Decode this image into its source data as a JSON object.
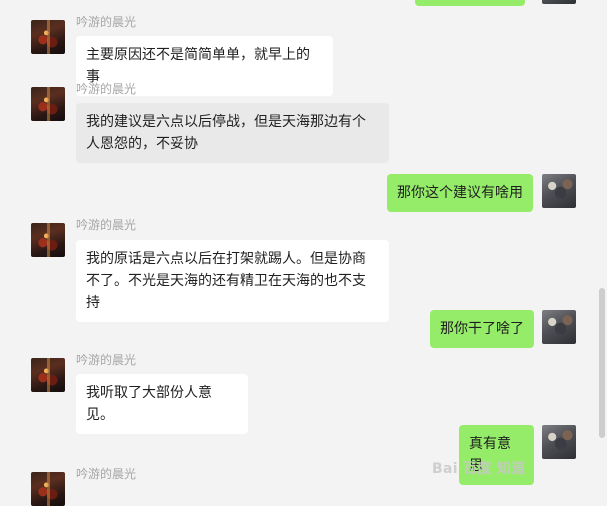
{
  "messages": [
    {
      "side": "in",
      "sender": "吟游的晨光",
      "text": "主要原因还不是简简单单，就早上的事"
    },
    {
      "side": "in",
      "sender": "吟游的晨光",
      "text": "我的建议是六点以后停战，但是天海那边有个人恩怨的，不妥协"
    },
    {
      "side": "out",
      "text": "那你这个建议有啥用"
    },
    {
      "side": "in",
      "sender": "吟游的晨光",
      "text": "我的原话是六点以后在打架就踢人。但是协商不了。不光是天海的还有精卫在天海的也不支持"
    },
    {
      "side": "out",
      "text": "那你干了啥了"
    },
    {
      "side": "in",
      "sender": "吟游的晨光",
      "text": "我听取了大部份人意见。"
    },
    {
      "side": "out",
      "text": "真有意思"
    },
    {
      "side": "in",
      "sender": "吟游的晨光",
      "text": ""
    }
  ],
  "watermark": "Bai 百度 知道"
}
